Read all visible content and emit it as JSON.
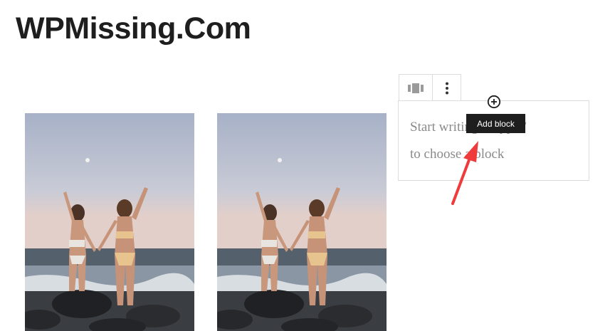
{
  "site": {
    "title": "WPMissing.Com"
  },
  "gallery": {
    "images": [
      {
        "name": "beach-photo-1"
      },
      {
        "name": "beach-photo-2"
      }
    ]
  },
  "block_toolbar": {
    "block_type_icon": "gallery-icon",
    "options_icon": "vertical-ellipsis-icon"
  },
  "paragraph_block": {
    "placeholder_line1": "Start writing or type /",
    "placeholder_line2": "to choose a block"
  },
  "inserter": {
    "icon": "plus-circle-icon",
    "tooltip": "Add block"
  },
  "annotation": {
    "arrow_color": "#ef3b3b"
  }
}
